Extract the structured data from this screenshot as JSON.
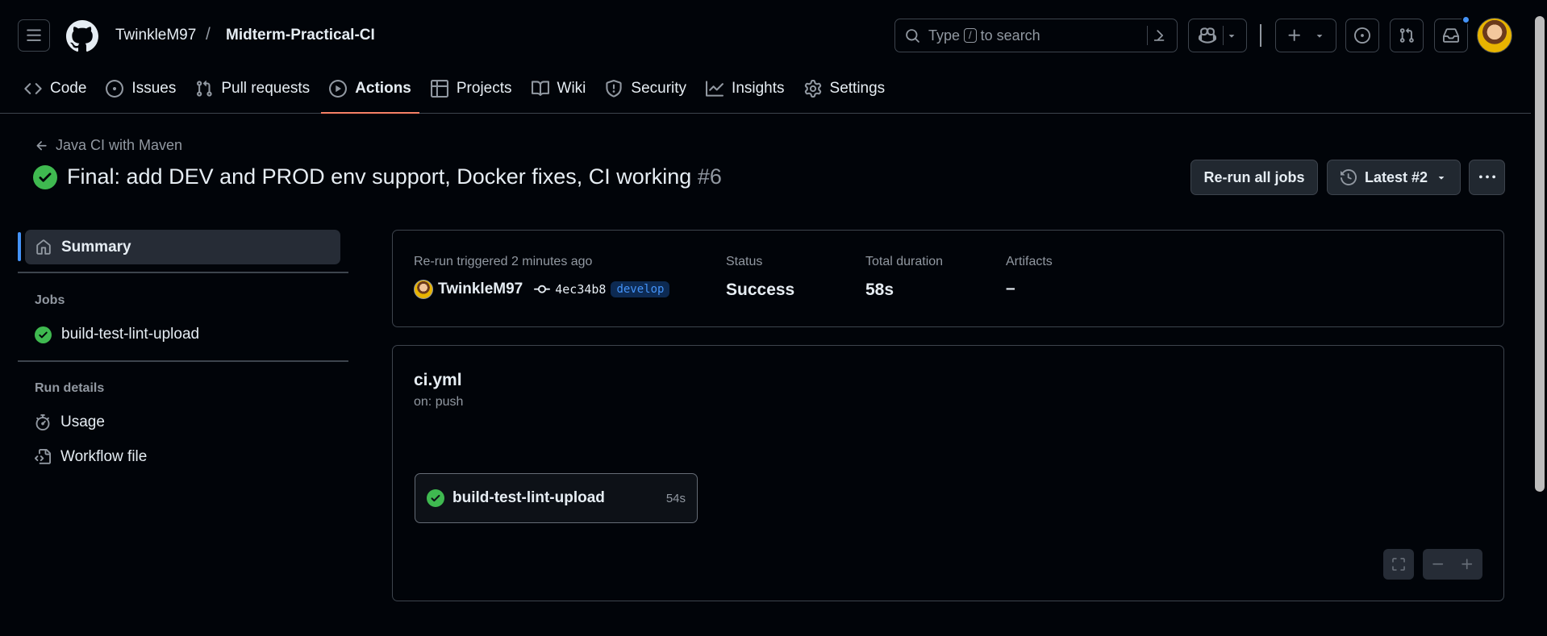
{
  "repo": {
    "owner": "TwinkleM97",
    "separator": "/",
    "name": "Midterm-Practical-CI"
  },
  "search": {
    "prefix": "Type",
    "key": "/",
    "suffix": "to search"
  },
  "tabs": [
    {
      "label": "Code",
      "icon": "code-icon"
    },
    {
      "label": "Issues",
      "icon": "issue-icon"
    },
    {
      "label": "Pull requests",
      "icon": "pull-request-icon"
    },
    {
      "label": "Actions",
      "icon": "play-icon",
      "active": true
    },
    {
      "label": "Projects",
      "icon": "table-icon"
    },
    {
      "label": "Wiki",
      "icon": "book-icon"
    },
    {
      "label": "Security",
      "icon": "shield-icon"
    },
    {
      "label": "Insights",
      "icon": "graph-icon"
    },
    {
      "label": "Settings",
      "icon": "gear-icon"
    }
  ],
  "run": {
    "back_label": "Java CI with Maven",
    "title": "Final: add DEV and PROD env support, Docker fixes, CI working",
    "number": "#6",
    "rerun_label": "Re-run all jobs",
    "attempt_label": "Latest #2"
  },
  "sidebar": {
    "summary_label": "Summary",
    "jobs_heading": "Jobs",
    "jobs": [
      {
        "label": "build-test-lint-upload",
        "status": "success"
      }
    ],
    "run_details_heading": "Run details",
    "details": [
      {
        "label": "Usage",
        "icon": "stopwatch-icon"
      },
      {
        "label": "Workflow file",
        "icon": "file-code-icon"
      }
    ]
  },
  "summary": {
    "trigger_label": "Re-run triggered 2 minutes ago",
    "actor": "TwinkleM97",
    "commit": "4ec34b8",
    "branch": "develop",
    "status_label": "Status",
    "status_value": "Success",
    "duration_label": "Total duration",
    "duration_value": "58s",
    "artifacts_label": "Artifacts",
    "artifacts_value": "–"
  },
  "workflow": {
    "file": "ci.yml",
    "trigger": "on: push",
    "job": {
      "label": "build-test-lint-upload",
      "duration": "54s"
    }
  },
  "colors": {
    "background": "#010409",
    "success": "#3fb950",
    "accent_underline": "#f78166",
    "link_blue": "#4493f8"
  }
}
